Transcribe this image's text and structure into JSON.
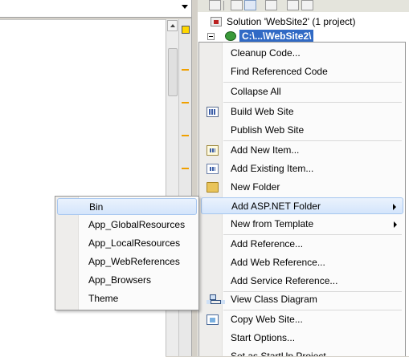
{
  "solution_explorer": {
    "solution_label": "Solution 'WebSite2' (1 project)",
    "project_label": "C:\\...\\WebSite2\\"
  },
  "context_menu": {
    "items": [
      {
        "label": "Cleanup Code...",
        "icon": "none"
      },
      {
        "label": "Find Referenced Code",
        "icon": "none"
      },
      {
        "label": "Collapse All",
        "icon": "none"
      },
      {
        "label": "Build Web Site",
        "icon": "build-icon"
      },
      {
        "label": "Publish Web Site",
        "icon": "none"
      },
      {
        "label": "Add New Item...",
        "icon": "add-new-item-icon"
      },
      {
        "label": "Add Existing Item...",
        "icon": "add-existing-item-icon"
      },
      {
        "label": "New Folder",
        "icon": "new-folder-icon"
      },
      {
        "label": "Add ASP.NET Folder",
        "icon": "none",
        "submenu": true,
        "highlighted": true
      },
      {
        "label": "New from Template",
        "icon": "none",
        "submenu": true
      },
      {
        "label": "Add Reference...",
        "icon": "none"
      },
      {
        "label": "Add Web Reference...",
        "icon": "none"
      },
      {
        "label": "Add Service Reference...",
        "icon": "none"
      },
      {
        "label": "View Class Diagram",
        "icon": "class-diagram-icon"
      },
      {
        "label": "Copy Web Site...",
        "icon": "copy-web-site-icon"
      },
      {
        "label": "Start Options...",
        "icon": "none"
      },
      {
        "label": "Set as StartUp Project",
        "icon": "none"
      }
    ]
  },
  "asp_net_folder_submenu": {
    "items": [
      {
        "label": "Bin",
        "highlighted": true
      },
      {
        "label": "App_GlobalResources"
      },
      {
        "label": "App_LocalResources"
      },
      {
        "label": "App_WebReferences"
      },
      {
        "label": "App_Browsers"
      },
      {
        "label": "Theme"
      }
    ]
  },
  "colors": {
    "selection": "#316ac5",
    "menu_highlight_border": "#a6c6ef",
    "margin_marker": "#f0a000"
  }
}
